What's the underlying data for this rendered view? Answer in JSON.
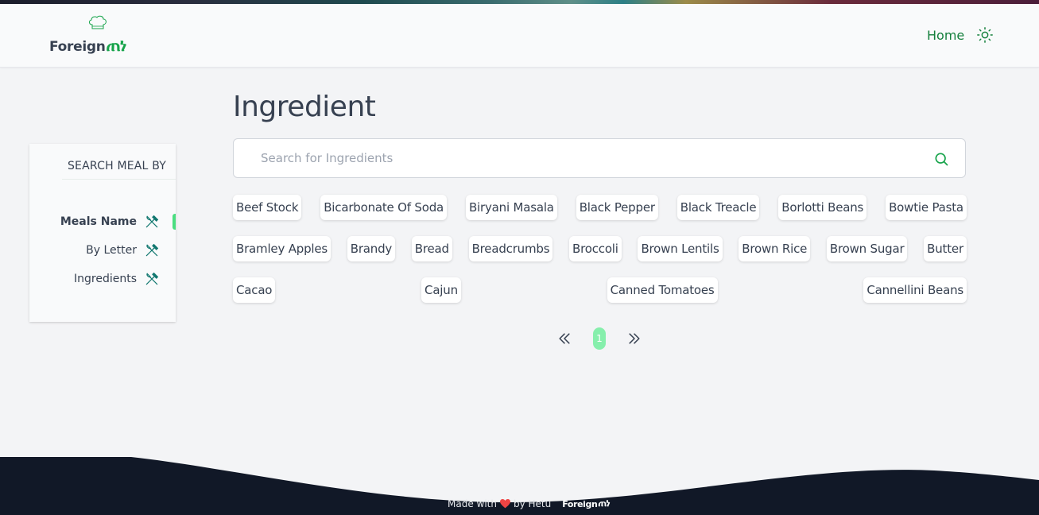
{
  "brand": {
    "word": "Foreign",
    "mark": "ጠነ"
  },
  "nav": {
    "home_label": "Home"
  },
  "sidebar": {
    "heading": "SEARCH MEAL BY",
    "items": [
      {
        "label": "Meals Name",
        "icon": "fork-knife-icon",
        "active": true
      },
      {
        "label": "By Letter",
        "icon": "fork-knife-icon",
        "active": false
      },
      {
        "label": "Ingredients",
        "icon": "fork-knife-icon",
        "active": false
      }
    ]
  },
  "page": {
    "title": "Ingredient"
  },
  "search": {
    "placeholder": "Search for Ingredients",
    "value": ""
  },
  "ingredients": {
    "row1": [
      "Beef Stock",
      "Bicarbonate Of Soda",
      "Biryani Masala",
      "Black Pepper",
      "Black Treacle",
      "Borlotti Beans",
      "Bowtie Pasta"
    ],
    "row2": [
      "Bramley Apples",
      "Brandy",
      "Bread",
      "Breadcrumbs",
      "Broccoli",
      "Brown Lentils",
      "Brown Rice",
      "Brown Sugar",
      "Butter"
    ],
    "row3": [
      "Cacao",
      "Cajun",
      "Canned Tomatoes",
      "Cannellini Beans"
    ]
  },
  "pagination": {
    "current_page": "1"
  },
  "footer": {
    "made_with": "Made with",
    "by": "by Hetu",
    "brand_word": "Foreign",
    "brand_mark": "ጠነ"
  },
  "colors": {
    "accent": "#16a34a",
    "active_bar": "#4ade80",
    "page_pill": "#86efac",
    "footer_bg": "#111827",
    "heart": "#ef4444"
  }
}
